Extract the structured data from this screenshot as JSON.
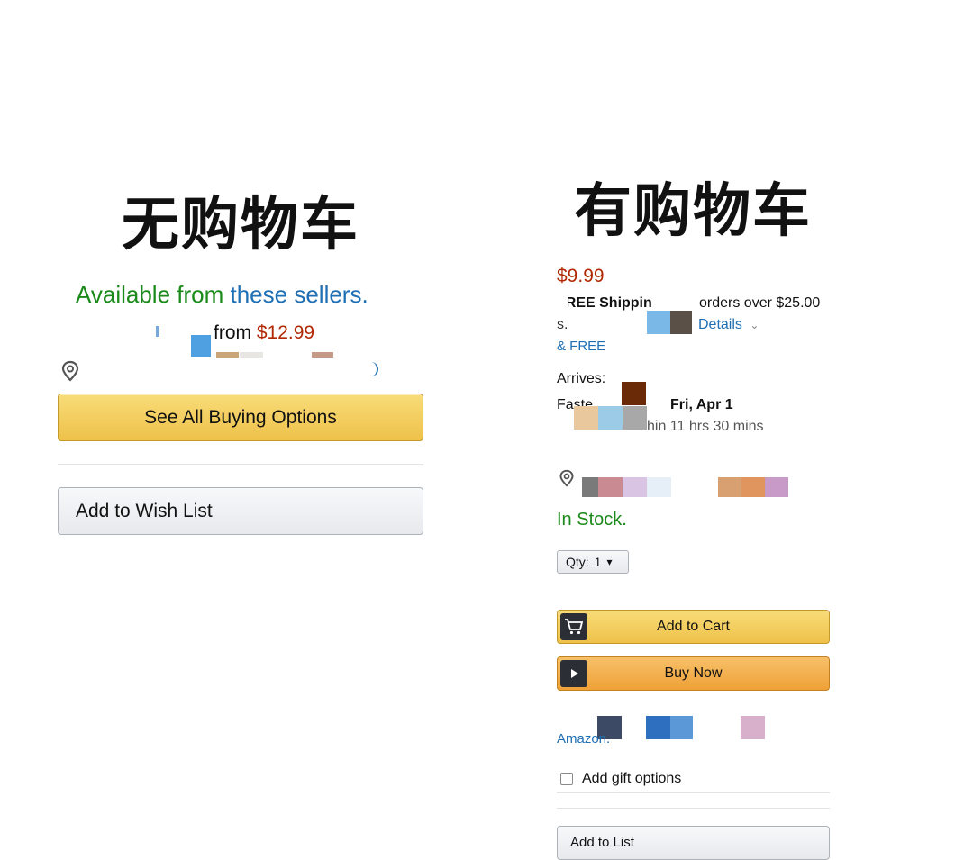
{
  "left": {
    "heading": "无购物车",
    "available_prefix": "Available from ",
    "available_link": "these sellers.",
    "from_prefix": "from ",
    "from_price": "$12.99",
    "see_all_button": "See All Buying Options",
    "wish_list_button": "Add to Wish List"
  },
  "right": {
    "heading": "有购物车",
    "price": "$9.99",
    "shipping_bold": "FREE Shippin",
    "shipping_rest": "orders over $25.00",
    "details_link": "Details",
    "free_prefix": "& FREE",
    "arrives_label": "Arrives:",
    "fastest_label": "Faste",
    "fastest_date": "Fri, Apr 1",
    "countdown_text": "hin 11 hrs 30 mins",
    "stock_status": "In Stock.",
    "qty_label": "Qty:",
    "qty_value": "1",
    "add_to_cart": "Add to Cart",
    "buy_now": "Buy Now",
    "sold_by_partial": "Amazon.",
    "gift_options": "Add gift options",
    "add_to_list": "Add to List"
  },
  "colors": {
    "green": "#1a8a1a",
    "link_blue": "#1f6fb5",
    "price_red": "#b12704"
  },
  "icons": [
    "location-pin-icon",
    "cart-icon",
    "play-icon",
    "chevron-down-icon",
    "checkbox-icon"
  ]
}
